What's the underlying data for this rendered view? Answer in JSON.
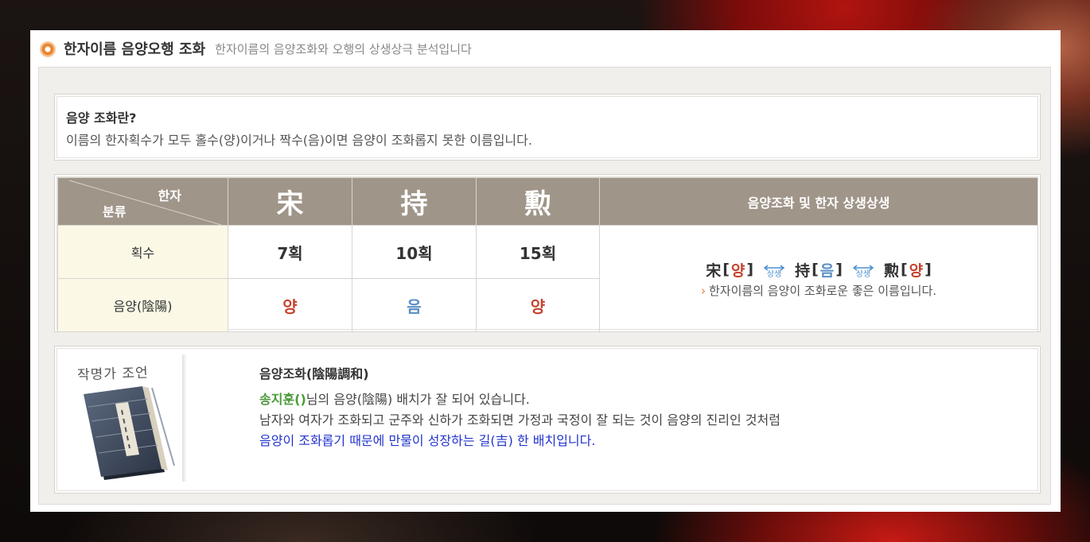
{
  "header": {
    "title": "한자이름 음양오행 조화",
    "subtitle": "한자이름의 음양조화와 오행의 상생상극 분석입니다"
  },
  "info": {
    "title": "음양 조화란?",
    "text": "이름의 한자획수가 모두 홀수(양)이거나 짝수(음)이면 음양이 조화롭지 못한 이름입니다."
  },
  "table": {
    "corner_top": "한자",
    "corner_bottom": "분류",
    "hanja": [
      "宋",
      "持",
      "勲"
    ],
    "right_header": "음양조화 및 한자 상생상생",
    "rows": [
      {
        "label": "획수",
        "values": [
          "7획",
          "10획",
          "15획"
        ]
      },
      {
        "label": "음양(陰陽)",
        "values": [
          "양",
          "음",
          "양"
        ],
        "types": [
          "yang",
          "eum",
          "yang"
        ]
      }
    ],
    "harmony": {
      "items": [
        {
          "hanja": "宋",
          "yy": "양"
        },
        {
          "hanja": "持",
          "yy": "음"
        },
        {
          "hanja": "勲",
          "yy": "양"
        }
      ],
      "relation": "상생",
      "message": "한자이름의 음양이 조화로운 좋은 이름입니다."
    }
  },
  "advice": {
    "book_caption": "작명가 조언",
    "title": "음양조화(陰陽調和)",
    "name": "송지훈()",
    "line1_rest": "님의 음양(陰陽) 배치가 잘 되어 있습니다.",
    "line2": "남자와 여자가 조화되고 군주와 신하가 조화되면 가정과 국정이 잘 되는 것이 음양의 진리인 것처럼",
    "line3": "음양이 조화롭기 때문에 만물이 성장하는 길(吉) 한 배치입니다."
  },
  "colors": {
    "yang": "#c5412c",
    "eum": "#5a8fc4",
    "header_bg": "#a09589",
    "label_bg": "#fbf9e6",
    "name": "#4b9a3a",
    "blue_text": "#2233cc"
  }
}
